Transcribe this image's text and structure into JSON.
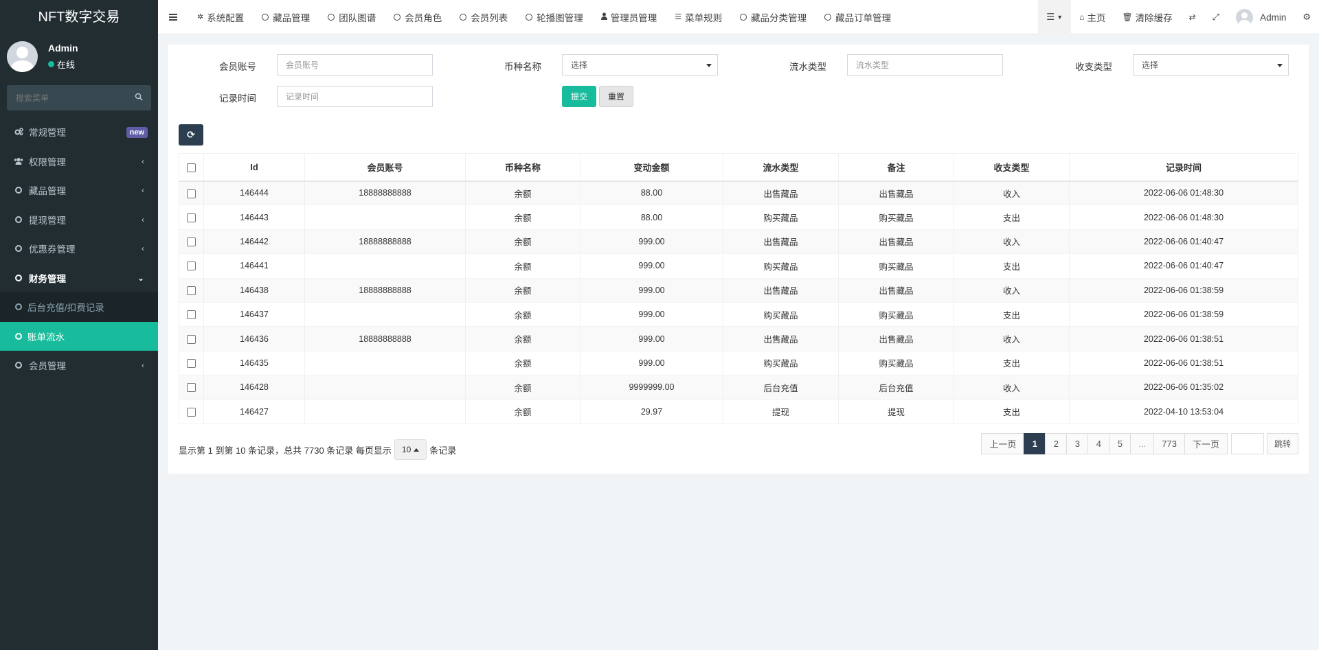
{
  "app": {
    "title": "NFT数字交易"
  },
  "user": {
    "name": "Admin",
    "status": "在线"
  },
  "sidebar": {
    "search_placeholder": "搜索菜单",
    "items": [
      {
        "label": "常规管理",
        "badge": "new",
        "icon": "cogs-icon"
      },
      {
        "label": "权限管理",
        "icon": "group-icon"
      },
      {
        "label": "藏品管理",
        "icon": "circle-o-icon"
      },
      {
        "label": "提现管理",
        "icon": "circle-o-icon"
      },
      {
        "label": "优惠券管理",
        "icon": "circle-o-icon"
      },
      {
        "label": "财务管理",
        "icon": "circle-o-icon"
      },
      {
        "label": "会员管理",
        "icon": "circle-o-icon"
      }
    ],
    "sub_items": [
      {
        "label": "后台充值/扣费记录"
      },
      {
        "label": "账单流水"
      }
    ]
  },
  "navbar": {
    "tabs": [
      {
        "label": "系统配置",
        "icon": "gear-icon"
      },
      {
        "label": "藏品管理",
        "icon": "circle-o-icon"
      },
      {
        "label": "团队图谱",
        "icon": "circle-o-icon"
      },
      {
        "label": "会员角色",
        "icon": "circle-o-icon"
      },
      {
        "label": "会员列表",
        "icon": "circle-o-icon"
      },
      {
        "label": "轮播图管理",
        "icon": "circle-o-icon"
      },
      {
        "label": "管理员管理",
        "icon": "user-icon"
      },
      {
        "label": "菜单规则",
        "icon": "bars-icon"
      },
      {
        "label": "藏品分类管理",
        "icon": "circle-o-icon"
      },
      {
        "label": "藏品订单管理",
        "icon": "circle-o-icon"
      }
    ],
    "home_label": "主页",
    "clear_cache_label": "清除缓存",
    "user_name": "Admin"
  },
  "filters": {
    "member_account": {
      "label": "会员账号",
      "placeholder": "会员账号"
    },
    "currency_name": {
      "label": "币种名称",
      "value": "选择"
    },
    "flow_type": {
      "label": "流水类型",
      "placeholder": "流水类型"
    },
    "income_type": {
      "label": "收支类型",
      "value": "选择"
    },
    "record_time": {
      "label": "记录时间",
      "placeholder": "记录时间"
    },
    "submit_label": "提交",
    "reset_label": "重置"
  },
  "table": {
    "columns": [
      "Id",
      "会员账号",
      "币种名称",
      "变动金额",
      "流水类型",
      "备注",
      "收支类型",
      "记录时间"
    ],
    "rows": [
      {
        "id": "146444",
        "account": "18888888888",
        "currency": "余额",
        "amount": "88.00",
        "flow": "出售藏品",
        "note": "出售藏品",
        "type": "收入",
        "time": "2022-06-06 01:48:30"
      },
      {
        "id": "146443",
        "account": "",
        "currency": "余额",
        "amount": "88.00",
        "flow": "购买藏品",
        "note": "购买藏品",
        "type": "支出",
        "time": "2022-06-06 01:48:30"
      },
      {
        "id": "146442",
        "account": "18888888888",
        "currency": "余额",
        "amount": "999.00",
        "flow": "出售藏品",
        "note": "出售藏品",
        "type": "收入",
        "time": "2022-06-06 01:40:47"
      },
      {
        "id": "146441",
        "account": "",
        "currency": "余额",
        "amount": "999.00",
        "flow": "购买藏品",
        "note": "购买藏品",
        "type": "支出",
        "time": "2022-06-06 01:40:47"
      },
      {
        "id": "146438",
        "account": "18888888888",
        "currency": "余额",
        "amount": "999.00",
        "flow": "出售藏品",
        "note": "出售藏品",
        "type": "收入",
        "time": "2022-06-06 01:38:59"
      },
      {
        "id": "146437",
        "account": "",
        "currency": "余额",
        "amount": "999.00",
        "flow": "购买藏品",
        "note": "购买藏品",
        "type": "支出",
        "time": "2022-06-06 01:38:59"
      },
      {
        "id": "146436",
        "account": "18888888888",
        "currency": "余额",
        "amount": "999.00",
        "flow": "出售藏品",
        "note": "出售藏品",
        "type": "收入",
        "time": "2022-06-06 01:38:51"
      },
      {
        "id": "146435",
        "account": "",
        "currency": "余额",
        "amount": "999.00",
        "flow": "购买藏品",
        "note": "购买藏品",
        "type": "支出",
        "time": "2022-06-06 01:38:51"
      },
      {
        "id": "146428",
        "account": "",
        "currency": "余额",
        "amount": "9999999.00",
        "flow": "后台充值",
        "note": "后台充值",
        "type": "收入",
        "time": "2022-06-06 01:35:02"
      },
      {
        "id": "146427",
        "account": "",
        "currency": "余额",
        "amount": "29.97",
        "flow": "提现",
        "note": "提现",
        "type": "支出",
        "time": "2022-04-10 13:53:04"
      }
    ]
  },
  "summary": {
    "text": "显示第 1 到第 10 条记录，总共 7730 条记录 每页显示",
    "page_size": "10",
    "suffix": "条记录"
  },
  "pagination": {
    "prev": "上一页",
    "pages": [
      "1",
      "2",
      "3",
      "4",
      "5",
      "...",
      "773"
    ],
    "next": "下一页",
    "jump": "跳转"
  },
  "colors": {
    "accent": "#18bc9c",
    "sidebar_bg": "#222d32",
    "dark_button": "#2c3e50"
  }
}
